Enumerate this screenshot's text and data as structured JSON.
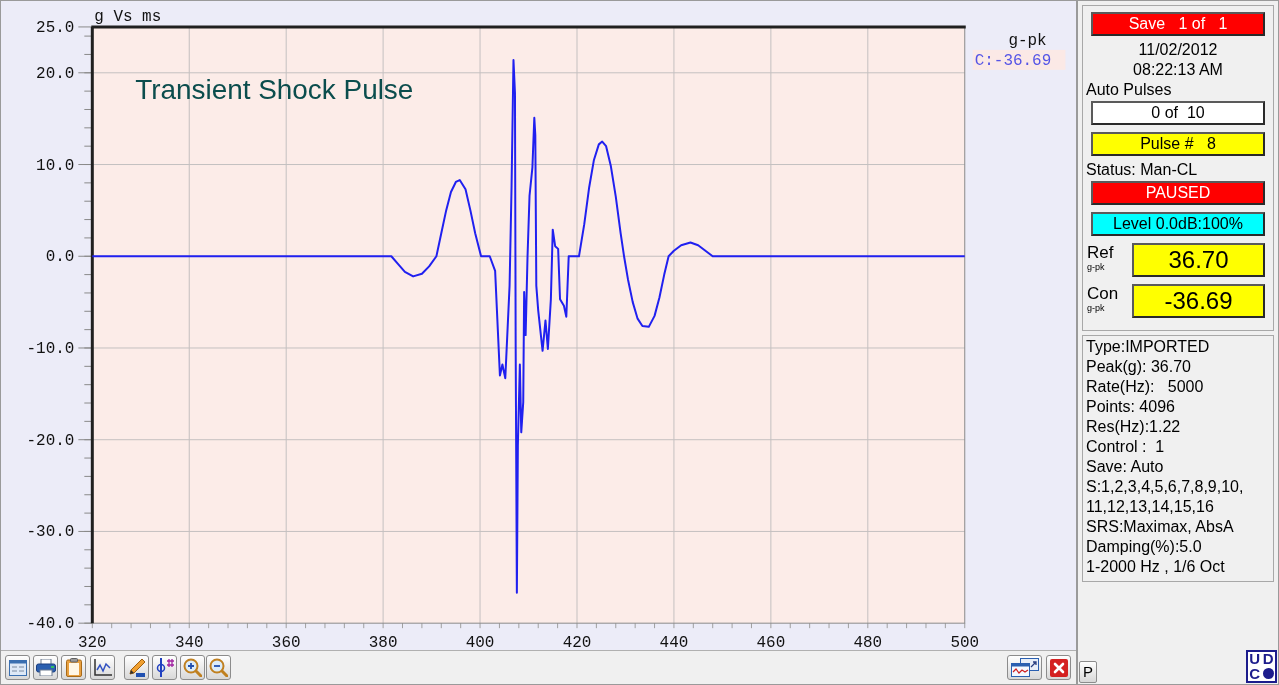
{
  "plot": {
    "unit_label": "g-pk",
    "chart_data": {
      "type": "line",
      "title": "g Vs ms",
      "grid": true,
      "x": [
        320,
        381.7,
        383,
        384.5,
        386.2,
        388,
        389.5,
        391,
        392,
        393,
        394,
        395,
        395.8,
        397,
        398,
        399,
        400.2,
        402,
        403.1,
        404.1,
        404.6,
        405.2,
        406.1,
        406.5,
        406.9,
        407.2,
        407.35,
        407.6,
        407.8,
        408.2,
        408.5,
        408.9,
        409.1,
        409.4,
        409.8,
        410.2,
        410.8,
        411.2,
        411.4,
        411.6,
        412,
        412.9,
        413.5,
        414,
        414.6,
        415,
        415.5,
        416.1,
        416.5,
        417.3,
        417.8,
        418.3,
        420.4,
        421.5,
        422.5,
        423.5,
        424.5,
        425.2,
        426,
        427,
        428,
        429,
        429.7,
        430.5,
        431.5,
        432.5,
        433.5,
        434.8,
        436,
        437,
        438,
        438.9,
        440,
        441.5,
        443.4,
        445,
        446.5,
        448,
        500
      ],
      "series": [
        {
          "name": "C:-36.69",
          "color": "#2020f0",
          "values": [
            0,
            0,
            -0.8,
            -1.7,
            -2.2,
            -1.9,
            -1.1,
            0,
            2.5,
            5,
            7,
            8.1,
            8.3,
            7.3,
            5,
            2.5,
            0,
            0,
            -1.6,
            -13,
            -11.8,
            -13.3,
            -3.2,
            7.7,
            21.4,
            17.8,
            -9.7,
            -36.7,
            -20.6,
            -11.8,
            -19.2,
            -15.9,
            -3.9,
            -8.6,
            0,
            6.6,
            9.7,
            15.1,
            13.2,
            -3.2,
            -5.9,
            -10.3,
            -7,
            -10.1,
            -4.7,
            2.9,
            1.1,
            0.8,
            -4.7,
            -5.4,
            -6.6,
            0,
            0,
            3.5,
            7.5,
            10.5,
            12.2,
            12.5,
            12,
            9.8,
            6.5,
            2.5,
            0,
            -2.5,
            -5,
            -6.8,
            -7.6,
            -7.7,
            -6.5,
            -4.5,
            -2,
            0,
            0.6,
            1.2,
            1.5,
            1.2,
            0.6,
            0,
            0
          ]
        }
      ],
      "xlim": [
        320,
        500
      ],
      "ylim": [
        -40,
        25
      ],
      "xticks": [
        320,
        340,
        360,
        380,
        400,
        420,
        440,
        460,
        480,
        500
      ],
      "yticks": [
        {
          "value": 25,
          "label": "25.0"
        },
        {
          "value": 20,
          "label": "20.0"
        },
        {
          "value": 10,
          "label": "10.0"
        },
        {
          "value": 0,
          "label": "0.0"
        },
        {
          "value": -10,
          "label": "-10.0"
        },
        {
          "value": -20,
          "label": "-20.0"
        },
        {
          "value": -30,
          "label": "-30.0"
        },
        {
          "value": -40,
          "label": "-40.0"
        }
      ],
      "annotations": [
        {
          "text": "Transient Shock Pulse"
        }
      ]
    }
  },
  "status_panel": {
    "items": [
      {
        "kind": "indicator",
        "text": "Save   1 of   1",
        "color": "#ff0000"
      },
      {
        "kind": "line",
        "text": "11/02/2012"
      },
      {
        "kind": "line",
        "text": "08:22:13 AM"
      },
      {
        "kind": "label",
        "text": "Auto Pulses"
      },
      {
        "kind": "indicator",
        "text": "0 of  10",
        "color": "#ffffff"
      },
      {
        "kind": "indicator",
        "text": "Pulse #   8",
        "color": "#ffff00"
      },
      {
        "kind": "label",
        "text": "Status: Man-CL"
      },
      {
        "kind": "indicator",
        "text": "PAUSED",
        "color": "#ff0000"
      },
      {
        "kind": "indicator",
        "text": "Level 0.0dB:100%",
        "color": "#00ffff"
      },
      {
        "kind": "reading",
        "label": "Ref",
        "unit": "g-pk",
        "value": "36.70",
        "color": "#ffff00"
      },
      {
        "kind": "reading",
        "label": "Con",
        "unit": "g-pk",
        "value": "-36.69",
        "color": "#ffff00"
      }
    ]
  },
  "info": [
    "Type:IMPORTED",
    "Peak(g): 36.70",
    "Rate(Hz):   5000",
    "Points: 4096",
    "Res(Hz):1.22",
    "Control :  1",
    "Save: Auto",
    "S:1,2,3,4,5,6,7,8,9,10,",
    "11,12,13,14,15,16",
    "SRS:Maximax, AbsA",
    "Damping(%):5.0",
    "1-2000 Hz , 1/6 Oct"
  ],
  "footer": {
    "p_button": "P",
    "logo": [
      "U",
      "D",
      "C"
    ]
  }
}
